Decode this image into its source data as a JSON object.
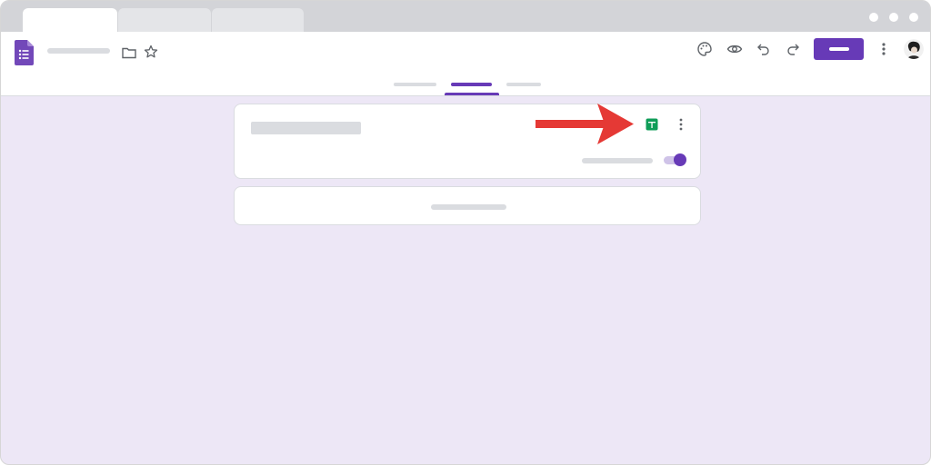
{
  "browser": {
    "tabs": [
      {
        "state": "active"
      },
      {
        "state": "inactive"
      },
      {
        "state": "inactive"
      }
    ]
  },
  "header": {
    "logo_icon": "google-forms-icon",
    "toolbar_icons": [
      "folder-icon",
      "star-icon",
      "palette-icon",
      "eye-icon",
      "undo-icon",
      "redo-icon",
      "more-vert-icon"
    ],
    "send_button": {
      "color": "#673ab7"
    }
  },
  "nav": {
    "active_index": 1,
    "accent": "#673ab7"
  },
  "responses_card": {
    "icons": [
      "sheets-icon",
      "more-vert-icon"
    ],
    "toggle": {
      "on": true,
      "color": "#673ab7"
    }
  },
  "annotation": {
    "arrow_color": "#e53935",
    "points_to": "sheets-icon"
  },
  "colors": {
    "page_background": "#ede7f6",
    "sheets_green": "#0f9d58"
  }
}
